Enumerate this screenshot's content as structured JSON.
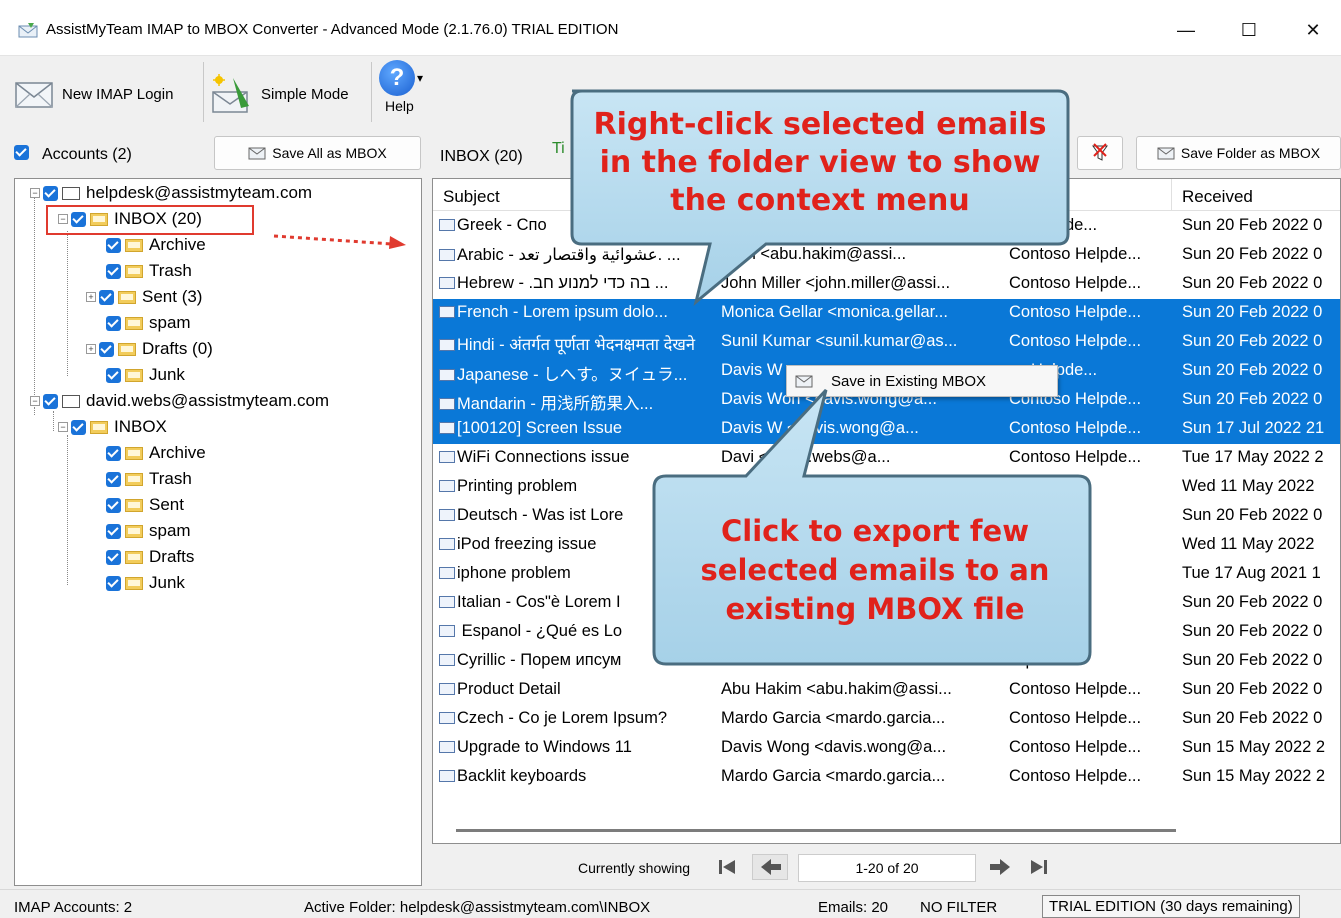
{
  "window": {
    "title": "AssistMyTeam IMAP to MBOX Converter - Advanced Mode (2.1.76.0) TRIAL EDITION",
    "minimize": "—",
    "maximize": "☐",
    "close": "✕"
  },
  "toolbar": {
    "new_login": "New IMAP Login",
    "simple_mode": "Simple Mode",
    "help": "Help",
    "help_glyph": "?",
    "dropdown_glyph": "▾"
  },
  "left": {
    "accounts_label": "Accounts (2)",
    "save_all_btn": "Save All as MBOX",
    "tree": [
      {
        "label": "helpdesk@assistmyteam.com",
        "type": "account"
      },
      {
        "label": "INBOX (20)",
        "type": "folder"
      },
      {
        "label": "Archive",
        "type": "folder"
      },
      {
        "label": "Trash",
        "type": "folder"
      },
      {
        "label": "Sent (3)",
        "type": "folder"
      },
      {
        "label": "spam",
        "type": "folder"
      },
      {
        "label": "Drafts (0)",
        "type": "folder"
      },
      {
        "label": "Junk",
        "type": "folder"
      },
      {
        "label": "david.webs@assistmyteam.com",
        "type": "account"
      },
      {
        "label": "INBOX",
        "type": "folder"
      },
      {
        "label": "Archive",
        "type": "folder"
      },
      {
        "label": "Trash",
        "type": "folder"
      },
      {
        "label": "Sent",
        "type": "folder"
      },
      {
        "label": "spam",
        "type": "folder"
      },
      {
        "label": "Drafts",
        "type": "folder"
      },
      {
        "label": "Junk",
        "type": "folder"
      }
    ]
  },
  "right": {
    "folder_label": "INBOX (20)",
    "tip_label": "Ti",
    "filter_glyph": "▾",
    "save_folder_btn": "Save Folder as MBOX",
    "columns": [
      "Subject",
      "Received"
    ],
    "rows": [
      {
        "subject": "Greek - Cпo",
        "from": "",
        "to": "so Helpde...",
        "received": "Sun 20 Feb 2022 0",
        "selected": false
      },
      {
        "subject": "Arabic - عشوائية واقتصار تعد. ...",
        "from": "akim <abu.hakim@assi...",
        "to": "Contoso Helpde...",
        "received": "Sun 20 Feb 2022 0",
        "selected": false
      },
      {
        "subject": "Hebrew - .בה כדי למנוע חב ...",
        "from": "John Miller <john.miller@assi...",
        "to": "Contoso Helpde...",
        "received": "Sun 20 Feb 2022 0",
        "selected": false
      },
      {
        "subject": "French - Lorem ipsum dolo...",
        "from": "Monica Gellar <monica.gellar...",
        "to": "Contoso Helpde...",
        "received": "Sun 20 Feb 2022 0",
        "selected": true
      },
      {
        "subject": "Hindi - अंतर्गत पूर्णता भेदनक्षमता देखने",
        "from": "Sunil Kumar <sunil.kumar@as...",
        "to": "Contoso Helpde...",
        "received": "Sun 20 Feb 2022 0",
        "selected": true
      },
      {
        "subject": "Japanese - しへす。ヌイュラ...",
        "from": "Davis W",
        "to": "so Helpde...",
        "received": "Sun 20 Feb 2022 0",
        "selected": true
      },
      {
        "subject": "Mandarin - 用浅所筋果入...",
        "from": "Davis Won <davis.wong@a...",
        "to": "Contoso Helpde...",
        "received": "Sun 20 Feb 2022 0",
        "selected": true
      },
      {
        "subject": "[100120] Screen Issue",
        "from": "Davis W <davis.wong@a...",
        "to": "Contoso Helpde...",
        "received": "Sun 17 Jul 2022 21",
        "selected": true
      },
      {
        "subject": "WiFi Connections issue",
        "from": "Davi <david.webs@a...",
        "to": "Contoso Helpde...",
        "received": "Tue 17 May 2022 2",
        "selected": false
      },
      {
        "subject": "Printing problem",
        "from": "",
        "to": "lelpde...",
        "received": "Wed 11 May 2022",
        "selected": false
      },
      {
        "subject": "Deutsch - Was ist Lore",
        "from": "",
        "to": "lelpde...",
        "received": "Sun 20 Feb 2022 0",
        "selected": false
      },
      {
        "subject": "iPod freezing issue",
        "from": "",
        "to": "lelpde...",
        "received": "Wed 11 May 2022",
        "selected": false
      },
      {
        "subject": "iphone problem",
        "from": "",
        "to": "k@ass...",
        "received": "Tue 17 Aug 2021 1",
        "selected": false
      },
      {
        "subject": "Italian - Cos\"è Lorem I",
        "from": "",
        "to": "lelpde...",
        "received": "Sun 20 Feb 2022 0",
        "selected": false
      },
      {
        "subject": " Espanol - ¿Qué es Lo",
        "from": "",
        "to": "lelpde...",
        "received": "Sun 20 Feb 2022 0",
        "selected": false
      },
      {
        "subject": "Cyrillic - Порем ипсум",
        "from": "",
        "to": "lelpde...",
        "received": "Sun 20 Feb 2022 0",
        "selected": false
      },
      {
        "subject": "Product Detail",
        "from": "Abu Hakim <abu.hakim@assi...",
        "to": "Contoso Helpde...",
        "received": "Sun 20 Feb 2022 0",
        "selected": false
      },
      {
        "subject": "Czech - Co je Lorem Ipsum?",
        "from": "Mardo Garcia <mardo.garcia...",
        "to": "Contoso Helpde...",
        "received": "Sun 20 Feb 2022 0",
        "selected": false
      },
      {
        "subject": "Upgrade to Windows 11",
        "from": "Davis Wong <davis.wong@a...",
        "to": "Contoso Helpde...",
        "received": "Sun 15 May 2022 2",
        "selected": false
      },
      {
        "subject": "Backlit keyboards",
        "from": "Mardo Garcia <mardo.garcia...",
        "to": "Contoso Helpde...",
        "received": "Sun 15 May 2022 2",
        "selected": false
      }
    ],
    "context_menu_item": "Save in Existing MBOX"
  },
  "pager": {
    "currently_showing": "Currently showing",
    "range": "1-20 of 20"
  },
  "status": {
    "accounts": "IMAP Accounts: 2",
    "active_folder": "Active Folder: helpdesk@assistmyteam.com\\INBOX",
    "emails": "Emails: 20",
    "filter": "NO FILTER",
    "trial": "TRIAL EDITION (30 days remaining)"
  },
  "callouts": {
    "top": "Right-click selected emails in the folder view to show the context menu",
    "bottom": "Click to export few selected emails to an existing MBOX file"
  },
  "colors": {
    "selection": "#0a78d7",
    "callout_text": "#e0221b",
    "highlight_box": "#e03a2f"
  }
}
